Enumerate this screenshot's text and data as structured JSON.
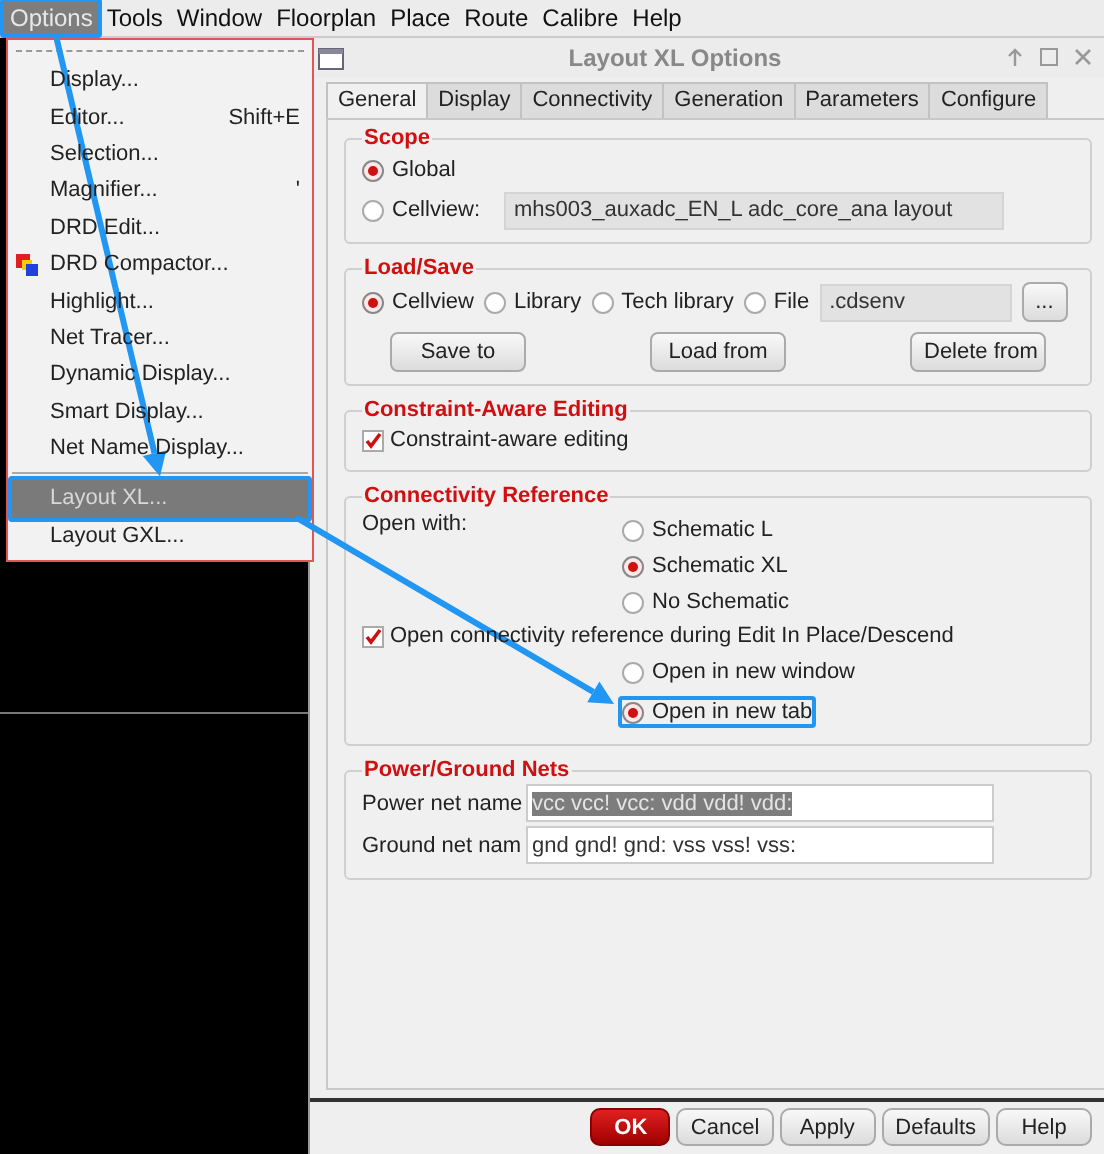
{
  "menubar": [
    {
      "label": "Options",
      "selected": true,
      "callout": true
    },
    {
      "label": "Tools",
      "selected": false
    },
    {
      "label": "Window",
      "selected": false
    },
    {
      "label": "Floorplan",
      "selected": false
    },
    {
      "label": "Place",
      "selected": false
    },
    {
      "label": "Route",
      "selected": false
    },
    {
      "label": "Calibre",
      "selected": false
    },
    {
      "label": "Help",
      "selected": false
    }
  ],
  "menu": {
    "items": [
      {
        "kind": "item",
        "label": "Display...",
        "selected": false
      },
      {
        "kind": "item",
        "label": "Editor...",
        "shortcut": "Shift+E",
        "selected": false
      },
      {
        "kind": "item",
        "label": "Selection...",
        "selected": false
      },
      {
        "kind": "item",
        "label": "Magnifier...",
        "shortcut": "'",
        "selected": false
      },
      {
        "kind": "item",
        "label": "DRD Edit...",
        "selected": false
      },
      {
        "kind": "icon-item",
        "label": "DRD Compactor...",
        "selected": false
      },
      {
        "kind": "item",
        "label": "Highlight...",
        "selected": false
      },
      {
        "kind": "item",
        "label": "Net Tracer...",
        "selected": false
      },
      {
        "kind": "item",
        "label": "Dynamic Display...",
        "selected": false
      },
      {
        "kind": "item",
        "label": "Smart Display...",
        "selected": false
      },
      {
        "kind": "item",
        "label": "Net Name Display...",
        "selected": false
      },
      {
        "kind": "separator"
      },
      {
        "kind": "item",
        "label": "Layout XL...",
        "selected": true,
        "callout": true
      },
      {
        "kind": "item",
        "label": "Layout GXL...",
        "selected": false
      }
    ]
  },
  "dialog": {
    "title": "Layout XL Options",
    "tabs": [
      {
        "label": "General",
        "selected": true
      },
      {
        "label": "Display",
        "selected": false
      },
      {
        "label": "Connectivity",
        "selected": false
      },
      {
        "label": "Generation",
        "selected": false
      },
      {
        "label": "Parameters",
        "selected": false
      },
      {
        "label": "Configure",
        "selected": false
      }
    ],
    "scope": {
      "title": "Scope",
      "options": [
        {
          "label": "Global",
          "selected": true
        },
        {
          "label": "Cellview:",
          "selected": false,
          "field": "mhs003_auxadc_EN_L adc_core_ana layout"
        }
      ]
    },
    "load_save": {
      "title": "Load/Save",
      "options": [
        {
          "label": "Cellview",
          "selected": true
        },
        {
          "label": "Library",
          "selected": false
        },
        {
          "label": "Tech library",
          "selected": false
        },
        {
          "label": "File",
          "selected": false,
          "field": ".cdsenv"
        }
      ],
      "browse": "...",
      "buttons": [
        "Save to",
        "Load from",
        "Delete from"
      ]
    },
    "constraint_aware_editing": {
      "title": "Constraint-Aware Editing",
      "checkbox": {
        "label": "Constraint-aware editing",
        "checked": true
      }
    },
    "connectivity_reference": {
      "title": "Connectivity Reference",
      "open_with_label": "Open with:",
      "open_with": [
        {
          "label": "Schematic L",
          "selected": false
        },
        {
          "label": "Schematic XL",
          "selected": true
        },
        {
          "label": "No Schematic",
          "selected": false
        }
      ],
      "checkbox": {
        "label": "Open connectivity reference during Edit In Place/Descend",
        "checked": true
      },
      "open_in": [
        {
          "label": "Open in new window",
          "selected": false
        },
        {
          "label": "Open in new tab",
          "selected": true,
          "callout": true
        }
      ]
    },
    "power_ground_nets": {
      "title": "Power/Ground Nets",
      "fields": [
        {
          "label": "Power net name",
          "value": "vcc vcc! vcc: vdd vdd! vdd:",
          "text_selected": true
        },
        {
          "label": "Ground net nam",
          "value": "gnd gnd! gnd: vss vss! vss:",
          "text_selected": false
        }
      ]
    },
    "buttons": [
      {
        "label": "OK",
        "default": true
      },
      {
        "label": "Cancel",
        "default": false
      },
      {
        "label": "Apply",
        "default": false
      },
      {
        "label": "Defaults",
        "default": false
      },
      {
        "label": "Help",
        "default": false
      }
    ]
  }
}
